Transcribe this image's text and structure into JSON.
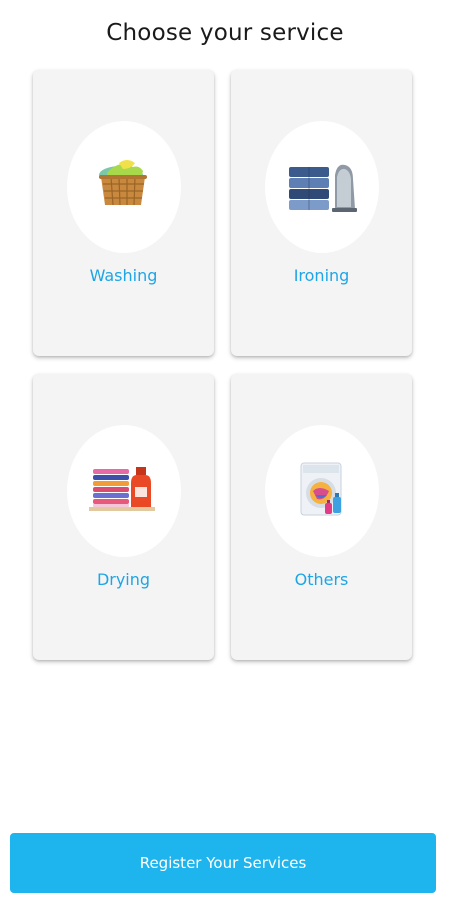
{
  "header": {
    "title": "Choose your service"
  },
  "services": [
    {
      "label": "Washing",
      "icon": "laundry-basket-icon"
    },
    {
      "label": "Ironing",
      "icon": "folded-shirts-iron-icon"
    },
    {
      "label": "Drying",
      "icon": "folded-clothes-detergent-icon"
    },
    {
      "label": "Others",
      "icon": "washing-machine-icon"
    }
  ],
  "footer": {
    "register_label": "Register Your Services"
  },
  "colors": {
    "accent": "#1eb4ee",
    "label": "#1ea5e6",
    "card": "#f4f4f4"
  }
}
